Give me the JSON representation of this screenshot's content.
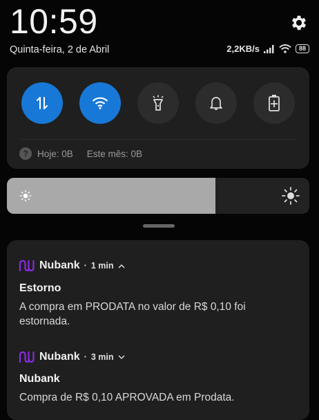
{
  "status_bar": {
    "time": "10:59",
    "date": "Quinta-feira, 2 de Abril",
    "network_speed": "2,2KB/s",
    "battery": "88",
    "icons": [
      "gear-icon",
      "signal-icon",
      "wifi-icon",
      "battery-icon"
    ]
  },
  "quick_settings": {
    "toggles": [
      {
        "name": "mobile-data",
        "icon": "data-transfer-icon",
        "active": true
      },
      {
        "name": "wifi",
        "icon": "wifi-icon",
        "active": true
      },
      {
        "name": "flashlight",
        "icon": "flashlight-icon",
        "active": false
      },
      {
        "name": "notifications",
        "icon": "bell-icon",
        "active": false
      },
      {
        "name": "battery-saver",
        "icon": "battery-plus-icon",
        "active": false
      }
    ],
    "usage_today": "Hoje: 0B",
    "usage_month": "Este mês: 0B",
    "help_glyph": "?",
    "accent_color": "#1878d8"
  },
  "brightness": {
    "level": 0.69
  },
  "notifications": [
    {
      "app": "Nubank",
      "time": "1 min",
      "expanded": true,
      "title": "Estorno",
      "body": "A compra em PRODATA no valor de R$ 0,10 foi estornada."
    },
    {
      "app": "Nubank",
      "time": "3 min",
      "expanded": false,
      "title": "Nubank",
      "body": "Compra de R$ 0,10 APROVADA em Prodata."
    }
  ],
  "brand_color": "#8a2be2",
  "separator": "·"
}
